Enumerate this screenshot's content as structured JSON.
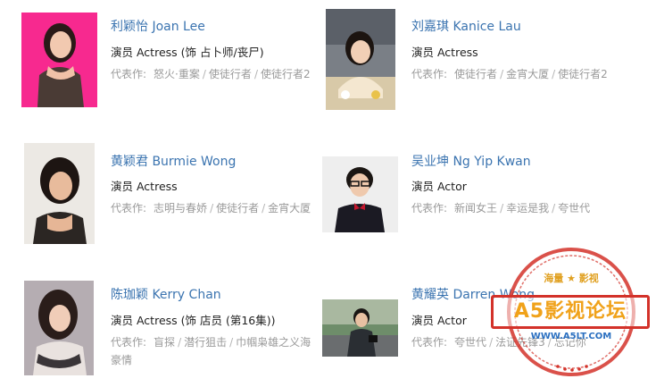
{
  "cast": [
    {
      "name": "利颖怡 Joan Lee",
      "role": "演员 Actress (饰 占卜师/丧尸)",
      "works_label": "代表作:",
      "works": [
        "怒火·重案",
        "使徒行者",
        "使徒行者2"
      ]
    },
    {
      "name": "刘嘉琪 Kanice Lau",
      "role": "演员 Actress",
      "works_label": "代表作:",
      "works": [
        "使徒行者",
        "金宵大厦",
        "使徒行者2"
      ]
    },
    {
      "name": "黄颖君 Burmie Wong",
      "role": "演员 Actress",
      "works_label": "代表作:",
      "works": [
        "志明与春娇",
        "使徒行者",
        "金宵大厦"
      ]
    },
    {
      "name": "吴业坤 Ng Yip Kwan",
      "role": "演员 Actor",
      "works_label": "代表作:",
      "works": [
        "新闻女王",
        "幸运是我",
        "夸世代"
      ]
    },
    {
      "name": "陈珈颖 Kerry Chan",
      "role": "演员 Actress (饰 店员 (第16集))",
      "works_label": "代表作:",
      "works": [
        "盲探",
        "潜行狙击",
        "巾帼枭雄之义海豪情"
      ]
    },
    {
      "name": "黄耀英 Darren Wong",
      "role": "演员 Actor",
      "works_label": "代表作:",
      "works": [
        "夸世代",
        "法证先锋3",
        "忘记你"
      ]
    }
  ],
  "watermark": {
    "top_text": "海量 ★ 影视",
    "band_text": "A5影视论坛",
    "url_text": "WWW.A5LT.COM",
    "ring_color": "#d3322a",
    "band_text_color": "#f0a21a",
    "url_color": "#2a6fc0"
  },
  "colors": {
    "name_link": "#3b74b0",
    "role_text": "#222222",
    "works_text": "#9a9a9a"
  }
}
